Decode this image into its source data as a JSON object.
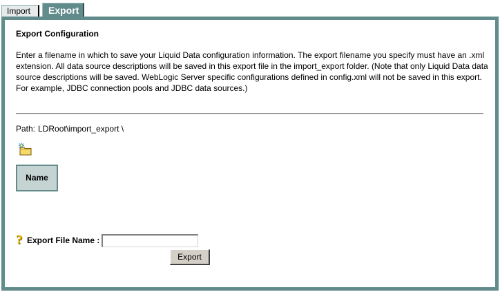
{
  "tabs": {
    "import_label": "Import",
    "export_label": "Export"
  },
  "colors": {
    "accent": "#628c8c",
    "header_bg": "#c6d3d3",
    "button_face": "#d4d0c8"
  },
  "page": {
    "title": "Export Configuration",
    "description": "Enter a filename in which to save your Liquid Data configuration information. The export filename you specify must have an .xml extension. All data source descriptions will be saved in this export file in the import_export folder. (Note that only Liquid Data data source descriptions will be saved. WebLogic Server specific configurations defined in config.xml will not be saved in this export. For example, JDBC connection pools and JDBC data sources.)",
    "path_label": "Path:",
    "path_value": "LDRoot\\import_export \\"
  },
  "icons": {
    "new_folder": "new-folder-icon",
    "help": "help-icon"
  },
  "table": {
    "name_header": "Name"
  },
  "form": {
    "file_name_label": "Export File Name :",
    "file_name_value": "",
    "export_button_label": "Export"
  }
}
